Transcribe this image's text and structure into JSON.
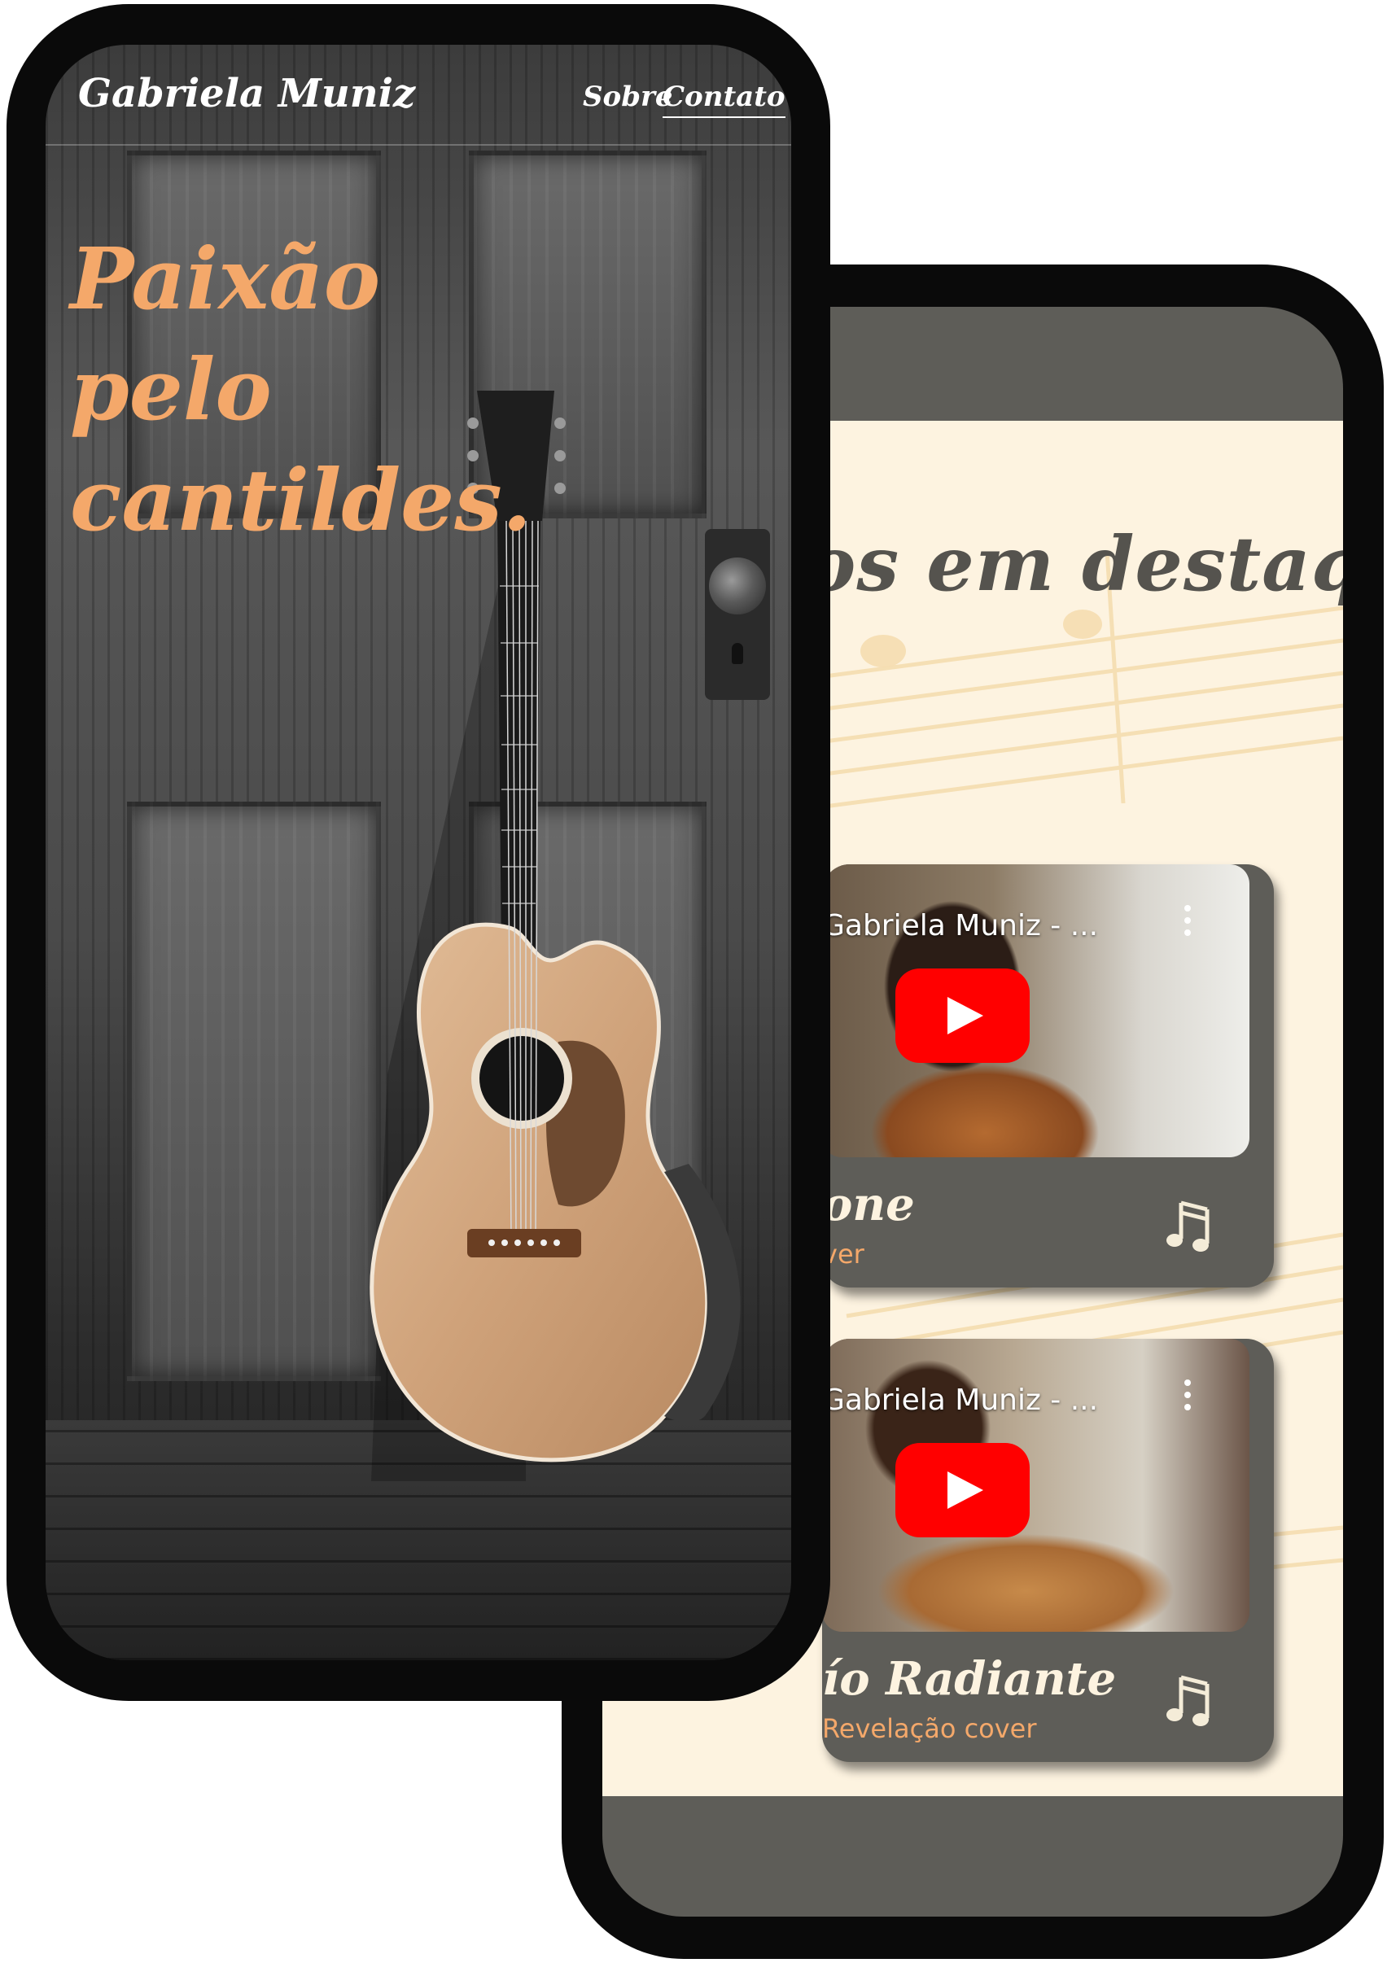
{
  "back_screen": {
    "section_title": "os em destaque",
    "videos": [
      {
        "thumb_title": "Gabriela Muniz - ...",
        "song_title": "one",
        "song_subtitle": "ver"
      },
      {
        "thumb_title": "Gabriela Muniz - ...",
        "song_title": "ío Radiante",
        "song_subtitle": "Revelação cover"
      }
    ],
    "colors": {
      "card": "#5e5d58",
      "cream": "#fdf3e0",
      "accent": "#f4a86a",
      "youtube_red": "#ff0000"
    },
    "icons": {
      "play": "youtube-play-icon",
      "menu": "kebab-menu-icon",
      "notes": "music-notes-icon"
    }
  },
  "front_screen": {
    "brand": "Gabriela Muniz",
    "nav": {
      "sobre": "Sobre",
      "contato": "Contato"
    },
    "hero_title": "Paixão pelo cantildes.",
    "colors": {
      "hero_text": "#f4a86a",
      "nav_text": "#ffffff"
    }
  }
}
